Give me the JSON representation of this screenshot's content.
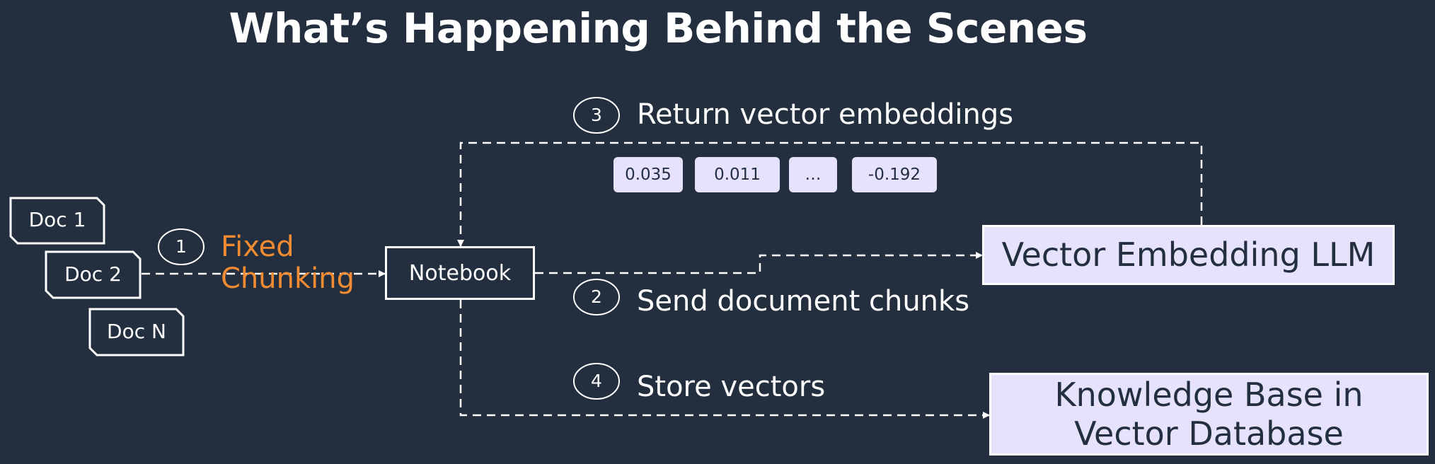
{
  "title": "What’s Happening Behind the Scenes",
  "documents": [
    "Doc 1",
    "Doc 2",
    "Doc N"
  ],
  "chunking": {
    "number": "1",
    "label_line1": "Fixed",
    "label_line2": "Chunking"
  },
  "notebook": "Notebook",
  "steps": [
    {
      "number": "2",
      "label": "Send document chunks"
    },
    {
      "number": "3",
      "label": "Return vector embeddings"
    },
    {
      "number": "4",
      "label": "Store vectors"
    }
  ],
  "embedding_values": [
    "0.035",
    "0.011",
    "…",
    "-0.192"
  ],
  "embedding_llm": "Vector Embedding LLM",
  "knowledge_base": {
    "line1": "Knowledge Base in",
    "line2": "Vector Database"
  },
  "colors": {
    "background": "#232f3e",
    "accent": "#f28b31",
    "box_fill": "#e6e2fb",
    "line": "#ffffff"
  }
}
